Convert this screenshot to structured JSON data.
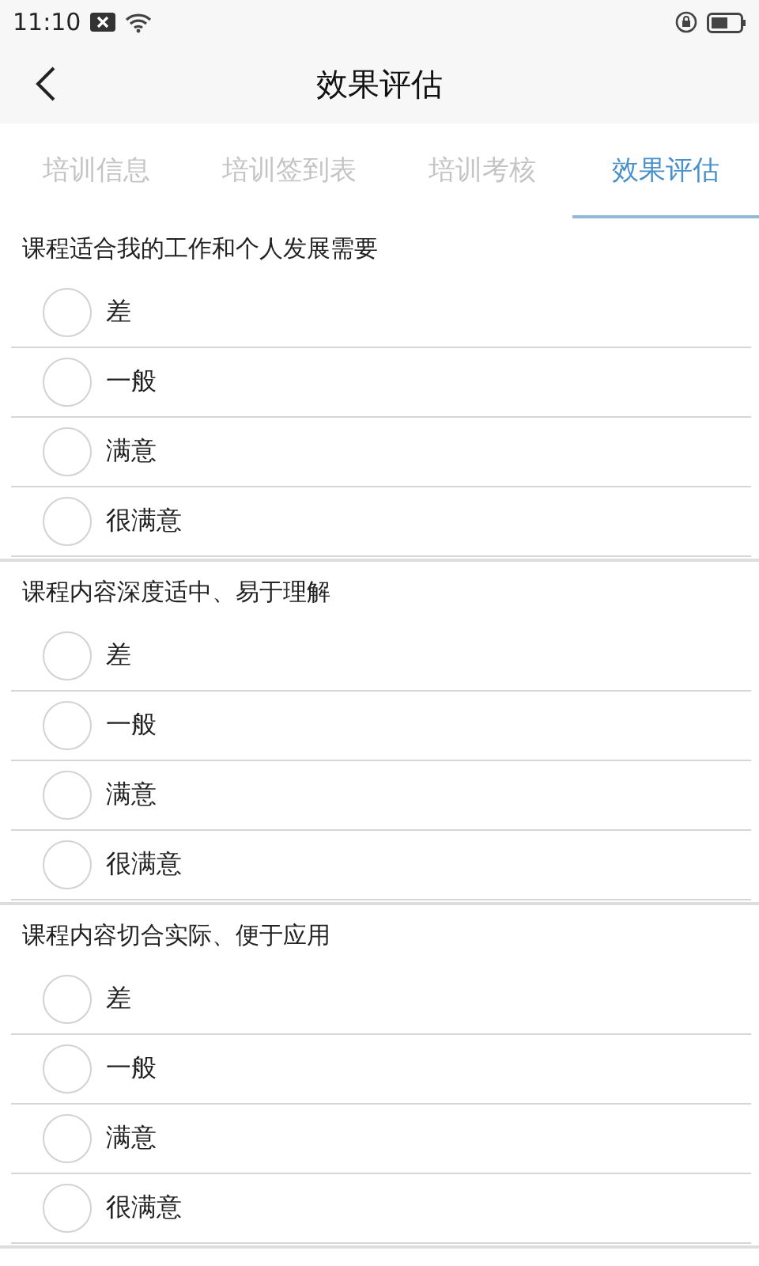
{
  "status_bar": {
    "time": "11:10"
  },
  "header": {
    "title": "效果评估"
  },
  "tabs": [
    {
      "label": "培训信息",
      "selected": false
    },
    {
      "label": "培训签到表",
      "selected": false
    },
    {
      "label": "培训考核",
      "selected": false
    },
    {
      "label": "效果评估",
      "selected": true
    }
  ],
  "questions": [
    {
      "text": "课程适合我的工作和个人发展需要",
      "options": [
        {
          "label": "差",
          "selected": false
        },
        {
          "label": "一般",
          "selected": false
        },
        {
          "label": "满意",
          "selected": false
        },
        {
          "label": "很满意",
          "selected": false
        }
      ]
    },
    {
      "text": "课程内容深度适中、易于理解",
      "options": [
        {
          "label": "差",
          "selected": false
        },
        {
          "label": "一般",
          "selected": false
        },
        {
          "label": "满意",
          "selected": false
        },
        {
          "label": "很满意",
          "selected": false
        }
      ]
    },
    {
      "text": "课程内容切合实际、便于应用",
      "options": [
        {
          "label": "差",
          "selected": false
        },
        {
          "label": "一般",
          "selected": false
        },
        {
          "label": "满意",
          "selected": false
        },
        {
          "label": "很满意",
          "selected": false
        }
      ]
    }
  ]
}
